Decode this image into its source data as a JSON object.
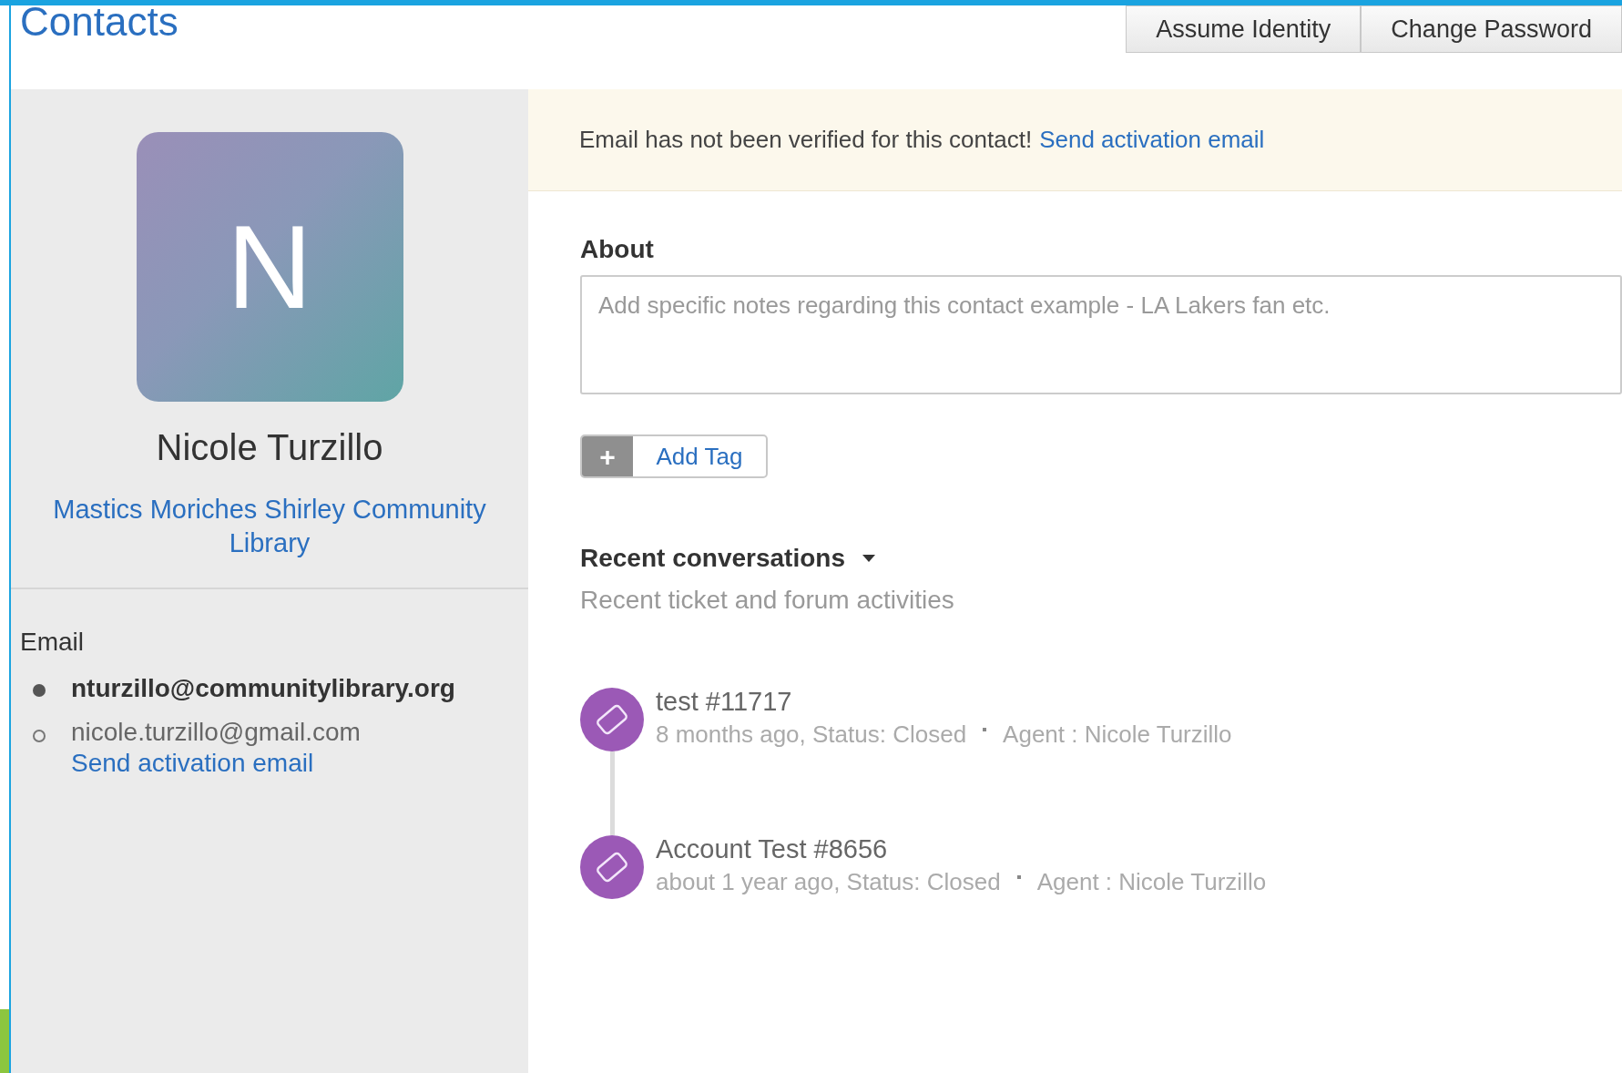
{
  "header": {
    "title": "Contacts",
    "buttons": [
      "Assume Identity",
      "Change Password"
    ]
  },
  "profile": {
    "avatar_initial": "N",
    "name": "Nicole Turzillo",
    "company": "Mastics Moriches Shirley Community Library"
  },
  "emails": {
    "label": "Email",
    "items": [
      {
        "address": "nturzillo@communitylibrary.org",
        "primary": true
      },
      {
        "address": "nicole.turzillo@gmail.com",
        "primary": false,
        "action": "Send activation email"
      }
    ]
  },
  "banner": {
    "message": "Email has not been verified for this contact!",
    "link": "Send activation email"
  },
  "about": {
    "heading": "About",
    "placeholder": "Add specific notes regarding this contact example - LA Lakers fan etc."
  },
  "add_tag": {
    "icon": "+",
    "label": "Add Tag"
  },
  "recent": {
    "heading": "Recent conversations",
    "subtitle": "Recent ticket and forum activities",
    "items": [
      {
        "title": "test #11717",
        "meta": "8 months ago, Status: Closed",
        "agent": "Agent : Nicole Turzillo"
      },
      {
        "title": "Account Test #8656",
        "meta": "about 1 year ago, Status: Closed",
        "agent": "Agent : Nicole Turzillo"
      }
    ]
  }
}
